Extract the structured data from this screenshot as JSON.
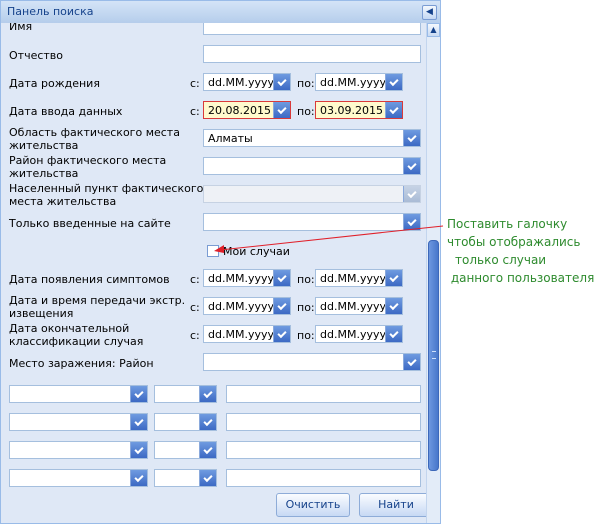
{
  "panel": {
    "title": "Панель поиска",
    "collapse_icon": "chevron-left-icon"
  },
  "fields": {
    "first_name": "Имя",
    "middle_name": "Отчество",
    "birth_date": "Дата рождения",
    "entry_date": "Дата ввода данных",
    "region_l1": "Область фактического места",
    "region_l2": "жительства",
    "district_l1": "Район фактического места",
    "district_l2": "жительства",
    "settlement_l1": "Населенный пункт фактического",
    "settlement_l2": "места жительства",
    "only_site": "Только введенные на сайте",
    "symptoms_date": "Дата появления симптомов",
    "transfer_l1": "Дата и время передачи экстр.",
    "transfer_l2": "извещения",
    "final_l1": "Дата окончательной",
    "final_l2": "классификации случая",
    "infection_place": "Место заражения: Район"
  },
  "range": {
    "from": "с:",
    "to": "по:"
  },
  "values": {
    "date_placeholder": "dd.MM.yyyy",
    "entry_from": "20.08.2015",
    "entry_to": "03.09.2015",
    "region": "Алматы"
  },
  "my_cases": {
    "label": "Мои случаи",
    "checked": false
  },
  "buttons": {
    "clear": "Очистить",
    "find": "Найти"
  },
  "annotation": {
    "lines": [
      "Поставить галочку",
      "чтобы отображались",
      "только случаи",
      " данного пользователя"
    ],
    "color": "#2e8b2e"
  },
  "colors": {
    "arrow": "#e0202a",
    "highlight_border": "#d93a3a",
    "highlight_bg": "#fffacd"
  }
}
